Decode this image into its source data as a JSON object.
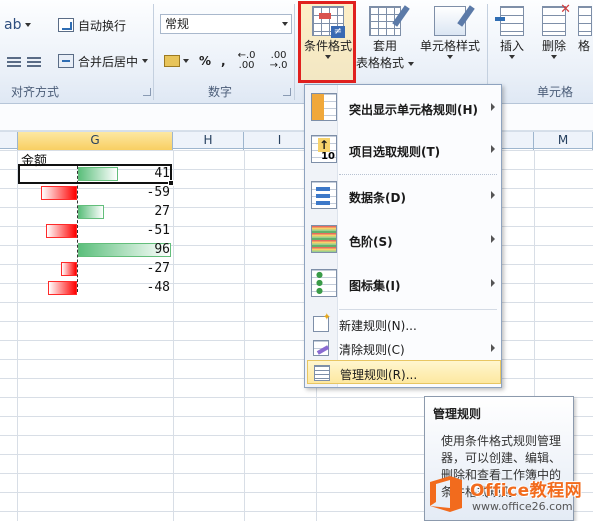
{
  "ribbon": {
    "wrap_text": "自动换行",
    "merge_center": "合并后居中",
    "number_format": "常规",
    "percent": "%",
    "comma": ",",
    "inc_decimal": "←.0 .00",
    "dec_decimal": ".00 →.0",
    "group_alignment": "对齐方式",
    "group_number": "数字",
    "group_cells": "单元格",
    "conditional_format_line1": "条件格式",
    "table_format_line1": "套用",
    "table_format_line2": "表格格式",
    "cell_styles": "单元格样式",
    "insert": "插入",
    "delete": "删除",
    "format": "格"
  },
  "columns": [
    "G",
    "H",
    "I",
    "M"
  ],
  "sheet": {
    "header_cell": "金额",
    "values": [
      41,
      -59,
      27,
      -51,
      96,
      -27,
      -48
    ]
  },
  "menu": {
    "items": [
      {
        "label": "突出显示单元格规则(H)"
      },
      {
        "label": "项目选取规则(T)"
      },
      {
        "label": "数据条(D)"
      },
      {
        "label": "色阶(S)"
      },
      {
        "label": "图标集(I)"
      }
    ],
    "new_rule": "新建规则(N)...",
    "clear_rules": "清除规则(C)",
    "manage_rules": "管理规则(R)..."
  },
  "tooltip": {
    "title": "管理规则",
    "body": "使用条件格式规则管理器，可以创建、编辑、删除和查看工作簿中的条件格式规则。"
  },
  "watermark": {
    "title": "Office教程网",
    "url": "www.office26.com"
  },
  "colors": {
    "highlight_border": "#e0201e",
    "positive_bar": "#63be7b",
    "negative_bar": "#ff0000",
    "watermark_orange": "#f26b1d"
  }
}
